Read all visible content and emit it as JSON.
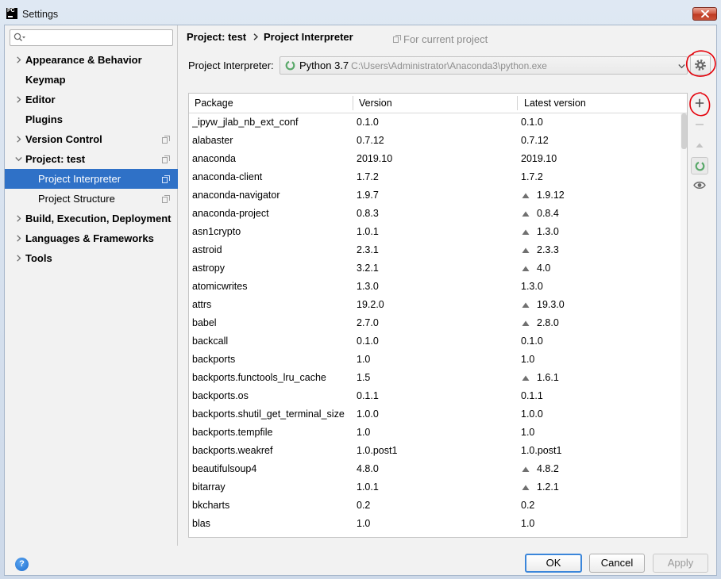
{
  "window": {
    "app_icon_text": "PC",
    "title": "Settings",
    "close_icon": "close-icon"
  },
  "sidebar": {
    "search": {
      "value": "",
      "placeholder": "",
      "icon": "search-icon"
    },
    "items": [
      {
        "label": "Appearance & Behavior",
        "has_children": true,
        "expanded": false,
        "child": false,
        "project_scoped": false,
        "selected": false
      },
      {
        "label": "Keymap",
        "has_children": false,
        "expanded": false,
        "child": false,
        "project_scoped": false,
        "selected": false
      },
      {
        "label": "Editor",
        "has_children": true,
        "expanded": false,
        "child": false,
        "project_scoped": false,
        "selected": false
      },
      {
        "label": "Plugins",
        "has_children": false,
        "expanded": false,
        "child": false,
        "project_scoped": false,
        "selected": false
      },
      {
        "label": "Version Control",
        "has_children": true,
        "expanded": false,
        "child": false,
        "project_scoped": true,
        "selected": false
      },
      {
        "label": "Project: test",
        "has_children": true,
        "expanded": true,
        "child": false,
        "project_scoped": true,
        "selected": false
      },
      {
        "label": "Project Interpreter",
        "has_children": false,
        "expanded": false,
        "child": true,
        "project_scoped": true,
        "selected": true
      },
      {
        "label": "Project Structure",
        "has_children": false,
        "expanded": false,
        "child": true,
        "project_scoped": true,
        "selected": false
      },
      {
        "label": "Build, Execution, Deployment",
        "has_children": true,
        "expanded": false,
        "child": false,
        "project_scoped": false,
        "selected": false
      },
      {
        "label": "Languages & Frameworks",
        "has_children": true,
        "expanded": false,
        "child": false,
        "project_scoped": false,
        "selected": false
      },
      {
        "label": "Tools",
        "has_children": true,
        "expanded": false,
        "child": false,
        "project_scoped": false,
        "selected": false
      }
    ]
  },
  "breadcrumb": {
    "parent": "Project: test",
    "current": "Project Interpreter"
  },
  "scope_label": "For current project",
  "interpreter": {
    "label": "Project Interpreter:",
    "name": "Python 3.7",
    "path": "C:\\Users\\Administrator\\Anaconda3\\python.exe"
  },
  "packages": {
    "columns": [
      "Package",
      "Version",
      "Latest version"
    ],
    "rows": [
      {
        "package": "_ipyw_jlab_nb_ext_conf",
        "version": "0.1.0",
        "latest": "0.1.0",
        "upgrade": false
      },
      {
        "package": "alabaster",
        "version": "0.7.12",
        "latest": "0.7.12",
        "upgrade": false
      },
      {
        "package": "anaconda",
        "version": "2019.10",
        "latest": "2019.10",
        "upgrade": false
      },
      {
        "package": "anaconda-client",
        "version": "1.7.2",
        "latest": "1.7.2",
        "upgrade": false
      },
      {
        "package": "anaconda-navigator",
        "version": "1.9.7",
        "latest": "1.9.12",
        "upgrade": true
      },
      {
        "package": "anaconda-project",
        "version": "0.8.3",
        "latest": "0.8.4",
        "upgrade": true
      },
      {
        "package": "asn1crypto",
        "version": "1.0.1",
        "latest": "1.3.0",
        "upgrade": true
      },
      {
        "package": "astroid",
        "version": "2.3.1",
        "latest": "2.3.3",
        "upgrade": true
      },
      {
        "package": "astropy",
        "version": "3.2.1",
        "latest": "4.0",
        "upgrade": true
      },
      {
        "package": "atomicwrites",
        "version": "1.3.0",
        "latest": "1.3.0",
        "upgrade": false
      },
      {
        "package": "attrs",
        "version": "19.2.0",
        "latest": "19.3.0",
        "upgrade": true
      },
      {
        "package": "babel",
        "version": "2.7.0",
        "latest": "2.8.0",
        "upgrade": true
      },
      {
        "package": "backcall",
        "version": "0.1.0",
        "latest": "0.1.0",
        "upgrade": false
      },
      {
        "package": "backports",
        "version": "1.0",
        "latest": "1.0",
        "upgrade": false
      },
      {
        "package": "backports.functools_lru_cache",
        "version": "1.5",
        "latest": "1.6.1",
        "upgrade": true
      },
      {
        "package": "backports.os",
        "version": "0.1.1",
        "latest": "0.1.1",
        "upgrade": false
      },
      {
        "package": "backports.shutil_get_terminal_size",
        "version": "1.0.0",
        "latest": "1.0.0",
        "upgrade": false
      },
      {
        "package": "backports.tempfile",
        "version": "1.0",
        "latest": "1.0",
        "upgrade": false
      },
      {
        "package": "backports.weakref",
        "version": "1.0.post1",
        "latest": "1.0.post1",
        "upgrade": false
      },
      {
        "package": "beautifulsoup4",
        "version": "4.8.0",
        "latest": "4.8.2",
        "upgrade": true
      },
      {
        "package": "bitarray",
        "version": "1.0.1",
        "latest": "1.2.1",
        "upgrade": true
      },
      {
        "package": "bkcharts",
        "version": "0.2",
        "latest": "0.2",
        "upgrade": false
      },
      {
        "package": "blas",
        "version": "1.0",
        "latest": "1.0",
        "upgrade": false
      }
    ]
  },
  "toolbar": [
    {
      "icon": "add-icon",
      "enabled": true
    },
    {
      "icon": "remove-icon",
      "enabled": false
    },
    {
      "icon": "upgrade-icon",
      "enabled": false
    },
    {
      "icon": "conda-package-manager-icon",
      "enabled": true,
      "pressed": true
    },
    {
      "icon": "eye-icon",
      "enabled": true
    }
  ],
  "buttons": {
    "help": "?",
    "ok": "OK",
    "cancel": "Cancel",
    "apply": "Apply",
    "apply_enabled": false
  },
  "colors": {
    "selection": "#2f71c7",
    "upgrade_arrow": "#707070",
    "conda_green": "#59a869",
    "annotation_red": "#e5000a",
    "muted_text": "#8c8c8c"
  }
}
